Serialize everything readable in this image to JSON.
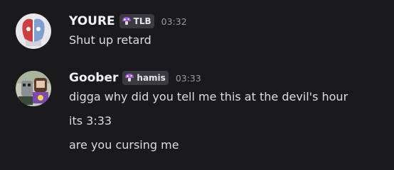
{
  "messages": [
    {
      "username": "YOURE",
      "tag": "TLB",
      "time": "03:32",
      "lines": [
        "Shut up retard"
      ]
    },
    {
      "username": "Goober",
      "tag": "hamis",
      "time": "03:33",
      "lines": [
        "digga why did you tell me this at the devil's hour",
        "its 3:33",
        "are you cursing me"
      ]
    }
  ],
  "colors": {
    "background": "#1a1a1e",
    "username": "#f2f3f5",
    "text": "#dbdee1",
    "timestamp": "#949ba4",
    "tag_bg": "#3a3a40",
    "mushroom": "#9b59d0"
  }
}
